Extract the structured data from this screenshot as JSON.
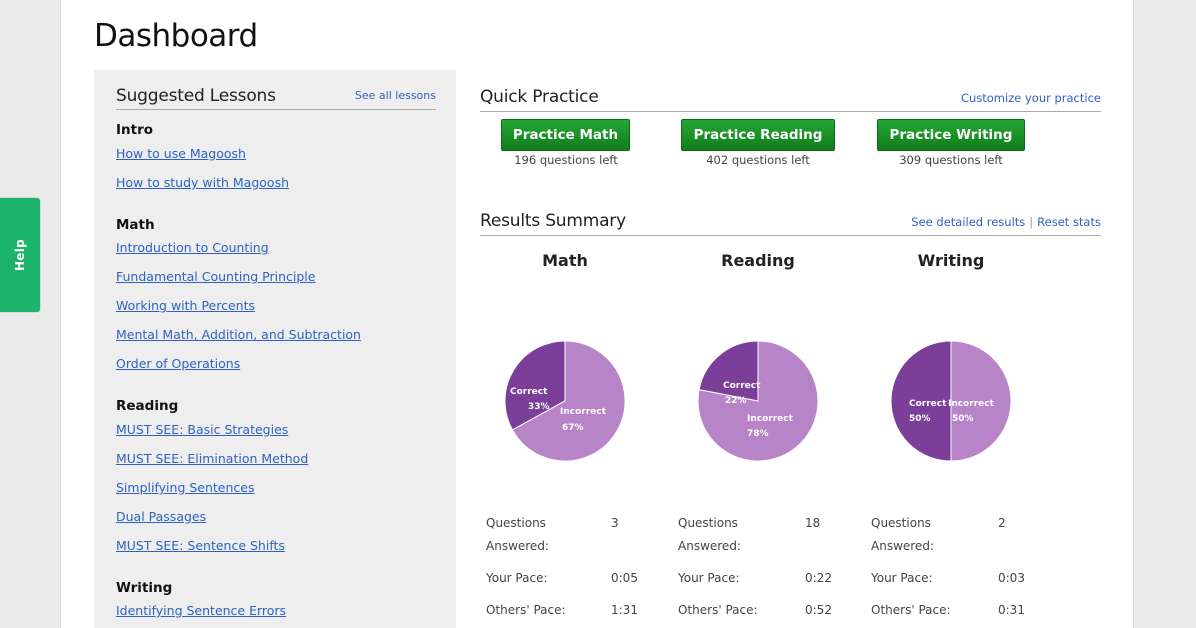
{
  "help_label": "Help",
  "page_title": "Dashboard",
  "suggested": {
    "title": "Suggested Lessons",
    "see_all": "See all lessons",
    "groups": [
      {
        "heading": "Intro",
        "links": [
          "How to use Magoosh",
          "How to study with Magoosh"
        ]
      },
      {
        "heading": "Math",
        "links": [
          "Introduction to Counting",
          "Fundamental Counting Principle",
          "Working with Percents",
          "Mental Math, Addition, and Subtraction",
          "Order of Operations"
        ]
      },
      {
        "heading": "Reading",
        "links": [
          "MUST SEE: Basic Strategies",
          "MUST SEE: Elimination Method",
          "Simplifying Sentences",
          "Dual Passages",
          "MUST SEE: Sentence Shifts"
        ]
      },
      {
        "heading": "Writing",
        "links": [
          "Identifying Sentence Errors"
        ]
      }
    ]
  },
  "quick_practice": {
    "title": "Quick Practice",
    "customize": "Customize your practice",
    "buttons": [
      {
        "label": "Practice Math",
        "left": "196 questions left"
      },
      {
        "label": "Practice Reading",
        "left": "402 questions left"
      },
      {
        "label": "Practice Writing",
        "left": "309 questions left"
      }
    ]
  },
  "results": {
    "title": "Results Summary",
    "detailed": "See detailed results",
    "reset": "Reset stats",
    "subjects": [
      {
        "name": "Math",
        "correct_label": "Correct",
        "correct_pct": "33%",
        "incorrect_label": "Incorrect",
        "incorrect_pct": "67%",
        "correct_value": 33,
        "answered_label": "Questions Answered:",
        "answered": "3",
        "pace_label": "Your Pace:",
        "pace": "0:05",
        "others_label": "Others' Pace:",
        "others": "1:31"
      },
      {
        "name": "Reading",
        "correct_label": "Correct",
        "correct_pct": "22%",
        "incorrect_label": "Incorrect",
        "incorrect_pct": "78%",
        "correct_value": 22,
        "answered_label": "Questions Answered:",
        "answered": "18",
        "pace_label": "Your Pace:",
        "pace": "0:22",
        "others_label": "Others' Pace:",
        "others": "0:52"
      },
      {
        "name": "Writing",
        "correct_label": "Correct",
        "correct_pct": "50%",
        "incorrect_label": "Incorrect",
        "incorrect_pct": "50%",
        "correct_value": 50,
        "answered_label": "Questions Answered:",
        "answered": "2",
        "pace_label": "Your Pace:",
        "pace": "0:03",
        "others_label": "Others' Pace:",
        "others": "0:31"
      }
    ]
  },
  "colors": {
    "correct": "#7b3f99",
    "incorrect": "#b784c8",
    "button": "#1e9b2b",
    "help": "#1cb36b",
    "link": "#2d62c4"
  }
}
